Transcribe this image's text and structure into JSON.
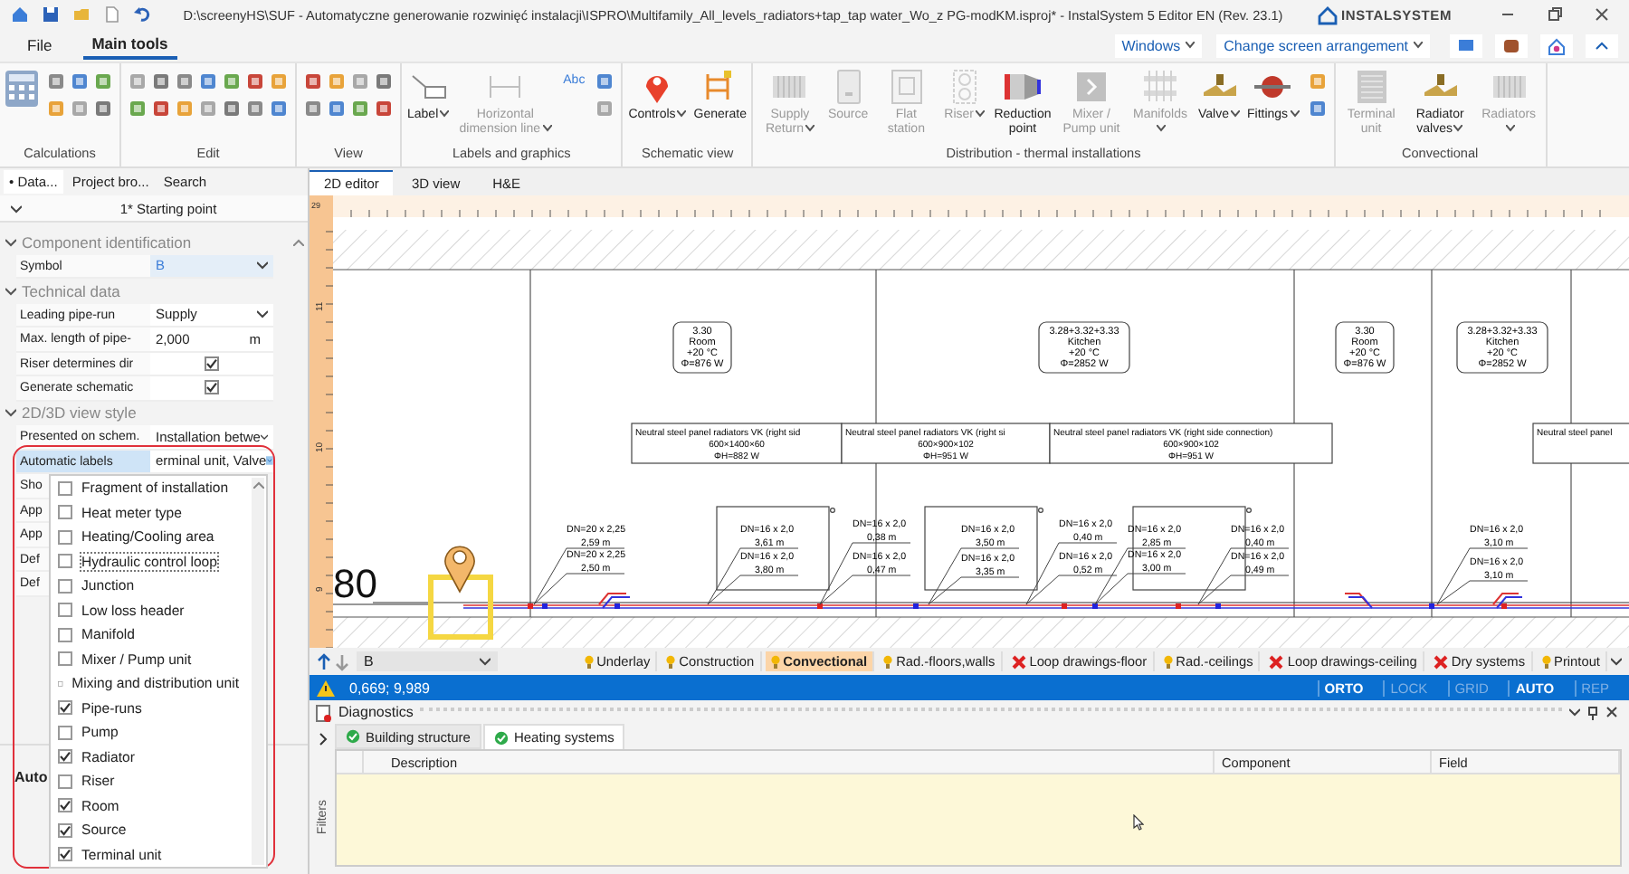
{
  "window": {
    "title": "D:\\screenyHS\\SUF - Automatyczne generowanie rozwinięć instalacji\\ISPRO\\Multifamily_All_levels_radiators+tap_tap water_Wo_z PG-modKM.isproj* - InstalSystem 5 Editor EN (Rev. 23.1)",
    "logo": "INSTALSYSTEM"
  },
  "ribbon_tabs": [
    {
      "label": "File",
      "selected": false
    },
    {
      "label": "Main tools",
      "selected": true
    }
  ],
  "ribbon_right": {
    "windows": "Windows",
    "arrangement": "Change screen arrangement"
  },
  "ribbon_groups": [
    {
      "label": "Calculations"
    },
    {
      "label": "Edit"
    },
    {
      "label": "View"
    },
    {
      "label": "Labels and graphics",
      "buttons": [
        {
          "label": "Label",
          "disabled": false,
          "dropdown": true
        },
        {
          "label": "Horizontal dimension line",
          "disabled": true,
          "dropdown": true
        }
      ],
      "text_tool": "Abc"
    },
    {
      "label": "Schematic view",
      "buttons": [
        {
          "label": "Controls",
          "disabled": false,
          "dropdown": true
        },
        {
          "label": "Generate",
          "disabled": false,
          "dropdown": false
        }
      ]
    },
    {
      "label": "Distribution - thermal installations",
      "buttons": [
        {
          "label": "Supply Return",
          "disabled": true,
          "dropdown": true
        },
        {
          "label": "Source",
          "disabled": true,
          "dropdown": false
        },
        {
          "label": "Flat station",
          "disabled": true,
          "dropdown": false
        },
        {
          "label": "Riser",
          "disabled": true,
          "dropdown": true
        },
        {
          "label": "Reduction point",
          "disabled": false,
          "dropdown": false
        },
        {
          "label": "Mixer / Pump unit",
          "disabled": true,
          "dropdown": false
        },
        {
          "label": "Manifolds",
          "disabled": true,
          "dropdown": true
        },
        {
          "label": "Valve",
          "disabled": false,
          "dropdown": true
        },
        {
          "label": "Fittings",
          "disabled": false,
          "dropdown": true
        }
      ]
    },
    {
      "label": "Convectional",
      "buttons": [
        {
          "label": "Terminal unit",
          "disabled": true,
          "dropdown": false
        },
        {
          "label": "Radiator valves",
          "disabled": false,
          "dropdown": true
        },
        {
          "label": "Radiators",
          "disabled": true,
          "dropdown": true
        }
      ]
    }
  ],
  "panel_tabs": [
    {
      "label": "• Data...",
      "selected": true
    },
    {
      "label": "Project bro...",
      "selected": false
    },
    {
      "label": "Search",
      "selected": false
    }
  ],
  "properties": {
    "header": "1* Starting point",
    "sections": [
      {
        "title": "Component identification",
        "expanded": true,
        "rows": [
          {
            "label": "Symbol",
            "kind": "dropdown",
            "value": "B",
            "selected": false
          }
        ]
      },
      {
        "title": "Technical data",
        "expanded": true,
        "rows": [
          {
            "label": "Leading pipe-run",
            "kind": "dropdown",
            "value": "Supply",
            "selected": false
          },
          {
            "label": "Max. length of pipe-",
            "kind": "number",
            "value": "2,000",
            "unit": "m",
            "selected": false
          },
          {
            "label": "Riser determines dir",
            "kind": "checkbox",
            "checked": true,
            "selected": false
          },
          {
            "label": "Generate schematic",
            "kind": "checkbox",
            "checked": true,
            "selected": false
          }
        ]
      },
      {
        "title": "2D/3D view style",
        "expanded": true,
        "rows": [
          {
            "label": "Presented on schem.",
            "kind": "dropdown",
            "value": "Installation betwe",
            "selected": false
          },
          {
            "label": "Automatic labels",
            "kind": "open",
            "value": "erminal unit, Valve",
            "selected": true
          },
          {
            "label": "Sho",
            "kind": "covered",
            "selected": false
          },
          {
            "label": "App",
            "kind": "covered",
            "selected": false
          },
          {
            "label": "App",
            "kind": "covered",
            "selected": false
          },
          {
            "label": "Def",
            "kind": "covered",
            "selected": false
          },
          {
            "label": "Def",
            "kind": "covered",
            "selected": false
          }
        ]
      }
    ],
    "description_title": "Auto"
  },
  "label_list": [
    {
      "label": "Fragment of installation",
      "checked": false,
      "focused": false
    },
    {
      "label": "Heat meter type",
      "checked": false,
      "focused": false
    },
    {
      "label": "Heating/Cooling area",
      "checked": false,
      "focused": false
    },
    {
      "label": "Hydraulic control loop",
      "checked": false,
      "focused": true
    },
    {
      "label": "Junction",
      "checked": false,
      "focused": false
    },
    {
      "label": "Low loss header",
      "checked": false,
      "focused": false
    },
    {
      "label": "Manifold",
      "checked": false,
      "focused": false
    },
    {
      "label": "Mixer / Pump unit",
      "checked": false,
      "focused": false
    },
    {
      "label": "Mixing and distribution unit",
      "checked": false,
      "focused": false
    },
    {
      "label": "Pipe-runs",
      "checked": true,
      "focused": false
    },
    {
      "label": "Pump",
      "checked": false,
      "focused": false
    },
    {
      "label": "Radiator",
      "checked": true,
      "focused": false
    },
    {
      "label": "Riser",
      "checked": false,
      "focused": false
    },
    {
      "label": "Room",
      "checked": true,
      "focused": false
    },
    {
      "label": "Source",
      "checked": true,
      "focused": false
    },
    {
      "label": "Terminal unit",
      "checked": true,
      "focused": false
    }
  ],
  "doc_tabs": [
    {
      "label": "2D editor",
      "selected": true
    },
    {
      "label": "3D view",
      "selected": false
    },
    {
      "label": "H&E",
      "selected": false
    }
  ],
  "canvas": {
    "ruler_corner": "29",
    "ruler_numbers": [
      "11",
      "10",
      "9"
    ],
    "level_label": "80",
    "rooms": [
      {
        "number": "3.30",
        "name": "Room",
        "temp": "+20 °C",
        "heat": "Φ=876 W"
      },
      {
        "number": "3.28+3.32+3.33",
        "name": "Kitchen",
        "temp": "+20 °C",
        "heat": "Φ=2852 W"
      },
      {
        "number": "3.30",
        "name": "Room",
        "temp": "+20 °C",
        "heat": "Φ=876 W"
      },
      {
        "number": "3.28+3.32+3.33",
        "name": "Kitchen",
        "temp": "+20 °C",
        "heat": "Φ=2852 W"
      }
    ],
    "radiators": [
      {
        "name": "Neutral steel panel radiators VK (right sid",
        "size": "600×1400×60",
        "heat": "ΦH=882 W"
      },
      {
        "name": "Neutral steel panel radiators VK (right si",
        "size": "600×900×102",
        "heat": "ΦH=951 W"
      },
      {
        "name": "Neutral steel panel radiators VK (right side connection)",
        "size": "600×900×102",
        "heat": "ΦH=951 W"
      },
      {
        "name": "Neutral steel panel"
      }
    ],
    "pipe_labels": [
      {
        "size": "DN=20 x 2,25",
        "length": "2,59 m"
      },
      {
        "size": "DN=20 x 2,25",
        "length": "2,50 m"
      },
      {
        "size": "DN=16 x 2,0",
        "length": "3,61 m"
      },
      {
        "size": "DN=16 x 2,0",
        "length": "3,80 m"
      },
      {
        "size": "DN=16 x 2,0",
        "length": "0,38 m"
      },
      {
        "size": "DN=16 x 2,0",
        "length": "0,47 m"
      },
      {
        "size": "DN=16 x 2,0",
        "length": "3,50 m"
      },
      {
        "size": "DN=16 x 2,0",
        "length": "3,35 m"
      },
      {
        "size": "DN=16 x 2,0",
        "length": "0,40 m"
      },
      {
        "size": "DN=16 x 2,0",
        "length": "0,52 m"
      },
      {
        "size": "DN=16 x 2,0",
        "length": "2,85 m"
      },
      {
        "size": "DN=16 x 2,0",
        "length": "3,00 m"
      },
      {
        "size": "DN=16 x 2,0",
        "length": "0,40 m"
      },
      {
        "size": "DN=16 x 2,0",
        "length": "0,49 m"
      },
      {
        "size": "DN=16 x 2,0",
        "length": "3,10 m"
      },
      {
        "size": "DN=16 x 2,0",
        "length": "3,10 m"
      }
    ]
  },
  "level_select": "B",
  "layers": [
    {
      "label": "Underlay",
      "visible": true,
      "selected": false
    },
    {
      "label": "Construction",
      "visible": true,
      "selected": false
    },
    {
      "label": "Convectional",
      "visible": true,
      "selected": true
    },
    {
      "label": "Rad.-floors,walls",
      "visible": true,
      "selected": false
    },
    {
      "label": "Loop drawings-floor",
      "visible": false,
      "selected": false
    },
    {
      "label": "Rad.-ceilings",
      "visible": true,
      "selected": false
    },
    {
      "label": "Loop drawings-ceiling",
      "visible": false,
      "selected": false
    },
    {
      "label": "Dry systems",
      "visible": false,
      "selected": false
    },
    {
      "label": "Printout",
      "visible": true,
      "selected": false
    }
  ],
  "status_bar": {
    "coords": "0,669; 9,989",
    "modes": [
      {
        "label": "ORTO",
        "on": true
      },
      {
        "label": "LOCK",
        "on": false
      },
      {
        "label": "GRID",
        "on": false
      },
      {
        "label": "AUTO",
        "on": true
      },
      {
        "label": "REP",
        "on": false
      }
    ]
  },
  "diagnostics": {
    "title": "Diagnostics",
    "side_label": "Filters",
    "tabs": [
      {
        "label": "Building structure",
        "selected": false
      },
      {
        "label": "Heating systems",
        "selected": true
      }
    ],
    "columns": [
      "Description",
      "Component",
      "Field"
    ]
  }
}
